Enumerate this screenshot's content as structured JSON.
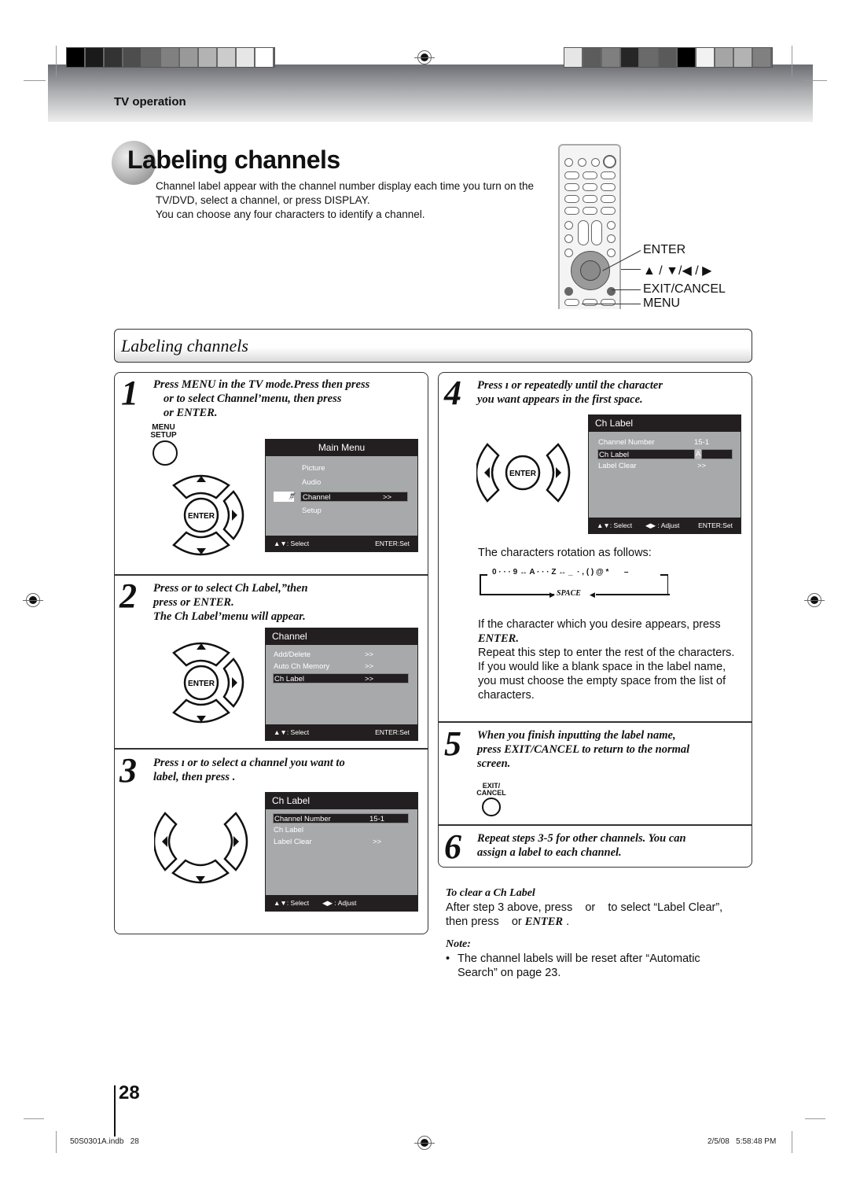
{
  "header": {
    "section": "TV operation",
    "color_bar_left": [
      "#000000",
      "#1a1a1a",
      "#333333",
      "#4d4d4d",
      "#666666",
      "#808080",
      "#999999",
      "#b3b3b3",
      "#cccccc",
      "#e6e6e6",
      "#ffffff"
    ],
    "color_bar_right": [
      "#e6e6e6",
      "#5c5c5c",
      "#7f7f7f",
      "#262626",
      "#6a6a6a",
      "#5a5a5a",
      "#000000",
      "#f2f2f2",
      "#a5a5a5",
      "#b3b3b3",
      "#808080"
    ]
  },
  "title": "Labeling channels",
  "intro": {
    "line1": "Channel label appear with the channel number display each time you turn on the TV/DVD, select a channel, or press DISPLAY.",
    "line2": "You can choose any four characters to identify a channel."
  },
  "remote_labels": {
    "enter": "ENTER",
    "arrows": "▲ / ▼/◀ / ▶",
    "exit": "EXIT/CANCEL",
    "menu": "MENU"
  },
  "section_bar": "Labeling channels",
  "steps": [
    {
      "num": "1",
      "text": "Press MENU in the TV mode.Press then press or to select Channel’menu, then press or ENTER.",
      "lines": [
        "Press MENU in the TV mode.Press then press",
        "or      to select Channel’menu, then press",
        "or ENTER."
      ],
      "button_label": "MENU\nSETUP",
      "osd": {
        "title": "Main Menu",
        "items": [
          "Picture",
          "Audio",
          "Channel",
          "Setup"
        ],
        "selected": "Channel",
        "selected_value": ">>",
        "footer_left": "▲▼: Select",
        "footer_right": "ENTER:Set"
      }
    },
    {
      "num": "2",
      "lines": [
        "Press      or      to select Ch Label,”then",
        "press      or ENTER.",
        "The Ch Label’menu will appear."
      ],
      "osd": {
        "title": "Channel",
        "items": [
          {
            "label": "Add/Delete",
            "value": ">>"
          },
          {
            "label": "Auto Ch Memory",
            "value": ">>"
          },
          {
            "label": "Ch Label",
            "value": ">>"
          }
        ],
        "selected": "Ch Label",
        "footer_left": "▲▼: Select",
        "footer_right": "ENTER:Set"
      }
    },
    {
      "num": "3",
      "lines": [
        "Press    ı or      to select a channel you want to",
        "label, then press        ."
      ],
      "osd": {
        "title": "Ch Label",
        "items": [
          {
            "label": "Channel Number",
            "value": "15-1"
          },
          {
            "label": "Ch Label",
            "value": ""
          },
          {
            "label": "Label Clear",
            "value": ">>"
          }
        ],
        "selected": "Channel Number",
        "footer_left": "▲▼: Select",
        "footer_mid": "◀▶ : Adjust"
      }
    },
    {
      "num": "4",
      "lines": [
        "Press    ı or      repeatedly until the character",
        "you want appears in the first space."
      ],
      "osd": {
        "title": "Ch Label",
        "items": [
          {
            "label": "Channel Number",
            "value": "15-1"
          },
          {
            "label": "Ch Label",
            "value": "A"
          },
          {
            "label": "Label Clear",
            "value": ">>"
          }
        ],
        "selected": "Ch Label",
        "footer_left": "▲▼: Select",
        "footer_mid": "◀▶ : Adjust",
        "footer_right": "ENTER:Set"
      },
      "rotation_intro": "The characters rotation as follows:",
      "rotation_sequence": "0 · · · 9 ↔ A · · · Z ↔ _  · , ( ) @ *       –",
      "rotation_space": "SPACE",
      "para1": "If the character which you desire appears, press",
      "para1_bold": "ENTER",
      "para2": "Repeat this step to enter the rest of the characters.",
      "para3": "If you would like a blank space in the label name, you must choose the empty space from the list of characters."
    },
    {
      "num": "5",
      "lines": [
        "When you finish inputting the label name,",
        "press EXIT/CANCEL to return to the normal",
        "screen."
      ],
      "button_label": "EXIT/\nCANCEL"
    },
    {
      "num": "6",
      "lines": [
        "Repeat steps 3-5 for other channels. You can",
        "assign a label to each channel."
      ]
    }
  ],
  "clear_label": {
    "heading": "To clear a Ch Label",
    "text1": "After step 3 above, press    or    to select “Label Clear”,",
    "text2": "then press    or ",
    "text2_bold": "ENTER",
    "text2_end": " ."
  },
  "note": {
    "heading": "Note:",
    "bullet": "The channel labels will be reset after “Automatic Search” on page 23."
  },
  "page_number": "28",
  "footer": {
    "file": "50S0301A.indb   28",
    "timestamp": "2/5/08   5:58:48 PM"
  },
  "dpad_center_label": "ENTER"
}
